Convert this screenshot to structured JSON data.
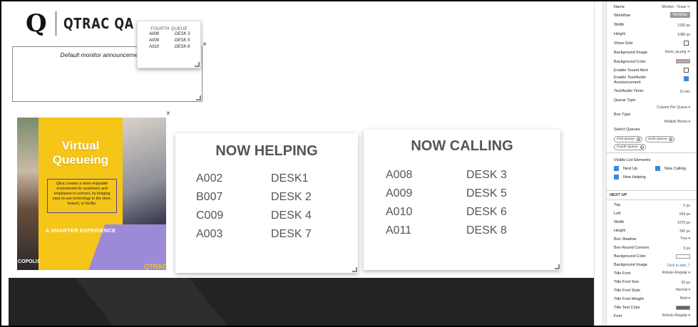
{
  "brand": {
    "logo_mark": "Q",
    "logo_text": "QTRAC QA"
  },
  "announcement": {
    "text": "Default monitor announcement text",
    "close": "×"
  },
  "mini_queue": {
    "title": "FOURTH QUEUE",
    "rows": [
      [
        "A008",
        "DESK 3"
      ],
      [
        "A009",
        "DESK 5"
      ],
      [
        "A010",
        "DESK 6"
      ]
    ]
  },
  "ad": {
    "headline": "Virtual Queueing",
    "body": "Qtrac creates a more enjoyable environment for customers and employees to connect, by bringing easy-to-use technology to the store, branch, or facility.",
    "cta": "A SMARTER EXPERIENCE",
    "brand": "QTRAC",
    "left_brand": "COPOLIS",
    "close": "×"
  },
  "now_helping": {
    "title": "NOW HELPING",
    "rows": [
      [
        "A002",
        "DESK1"
      ],
      [
        "B007",
        "DESK 2"
      ],
      [
        "C009",
        "DESK 4"
      ],
      [
        "A003",
        "DESK 7"
      ]
    ]
  },
  "now_calling": {
    "title": "NOW CALLING",
    "rows": [
      [
        "A008",
        "DESK 3"
      ],
      [
        "A009",
        "DESK 5"
      ],
      [
        "A010",
        "DESK 6"
      ],
      [
        "A011",
        "DESK 8"
      ]
    ]
  },
  "sidebar": {
    "props": [
      {
        "label": "Name",
        "value": "Monitor - Texas ✎"
      },
      {
        "label": "Workflow",
        "value": "Workflow"
      },
      {
        "label": "Width",
        "value": "1920 px"
      },
      {
        "label": "Height",
        "value": "1080 px"
      },
      {
        "label": "Show Grid",
        "value": ""
      },
      {
        "label": "Background Image",
        "value": "kiosk_qa.png  ✕"
      },
      {
        "label": "Background Color",
        "value": ""
      },
      {
        "label": "Enable Sound Alert",
        "value": ""
      },
      {
        "label": "Enable Text/Audio Announcement",
        "value": ""
      },
      {
        "label": "Text/Audio Timer",
        "value": "10 sec"
      },
      {
        "label": "Queue Type",
        "value": ""
      },
      {
        "label": "",
        "value": "Column Per Queue ▾"
      },
      {
        "label": "Box Type",
        "value": ""
      },
      {
        "label": "",
        "value": "Multiple Boxes ▾"
      },
      {
        "label": "Select Queues",
        "value": ""
      }
    ],
    "chips": [
      "First Queue",
      "Sixth Queue",
      "Fourth Queue"
    ],
    "visible_title": "Visible List Elements",
    "visible": [
      "Next Up",
      "Now Calling",
      "Now Helping"
    ],
    "section2": "NEXT UP",
    "props2": [
      {
        "label": "Top",
        "value": "0 px"
      },
      {
        "label": "Left",
        "value": "659 px"
      },
      {
        "label": "Width",
        "value": "1075 px"
      },
      {
        "label": "Height",
        "value": "392 px"
      },
      {
        "label": "Box Shadow",
        "value": "True ▾"
      },
      {
        "label": "Box Round Corners",
        "value": "5 px"
      },
      {
        "label": "Background Color",
        "value": ""
      },
      {
        "label": "Background Image",
        "value": "Click to add ⤴"
      },
      {
        "label": "Title Font",
        "value": "Roboto-Regular ▾"
      },
      {
        "label": "Title Font Size",
        "value": "50 px"
      },
      {
        "label": "Title Font Style",
        "value": "Normal ▾"
      },
      {
        "label": "Title Font Weight",
        "value": "Bold ▾"
      },
      {
        "label": "Title Text Color",
        "value": ""
      },
      {
        "label": "Font",
        "value": "Roboto-Regular ▾"
      }
    ]
  }
}
